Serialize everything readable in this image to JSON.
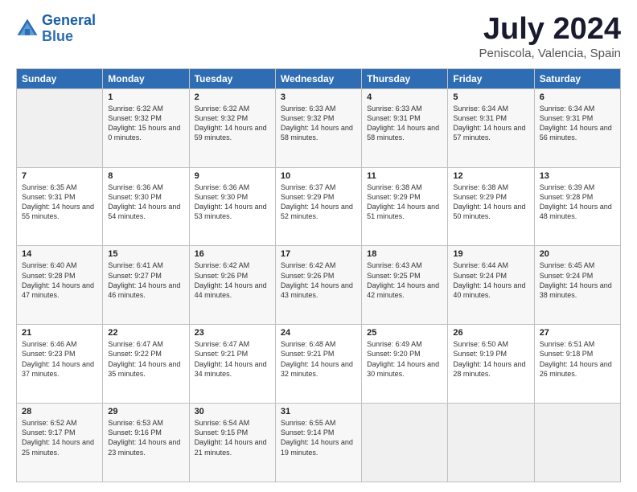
{
  "logo": {
    "line1": "General",
    "line2": "Blue"
  },
  "title": "July 2024",
  "subtitle": "Peniscola, Valencia, Spain",
  "days_of_week": [
    "Sunday",
    "Monday",
    "Tuesday",
    "Wednesday",
    "Thursday",
    "Friday",
    "Saturday"
  ],
  "weeks": [
    [
      {
        "day": "",
        "empty": true
      },
      {
        "day": "1",
        "sunrise": "6:32 AM",
        "sunset": "9:32 PM",
        "daylight": "15 hours and 0 minutes."
      },
      {
        "day": "2",
        "sunrise": "6:32 AM",
        "sunset": "9:32 PM",
        "daylight": "14 hours and 59 minutes."
      },
      {
        "day": "3",
        "sunrise": "6:33 AM",
        "sunset": "9:32 PM",
        "daylight": "14 hours and 58 minutes."
      },
      {
        "day": "4",
        "sunrise": "6:33 AM",
        "sunset": "9:31 PM",
        "daylight": "14 hours and 58 minutes."
      },
      {
        "day": "5",
        "sunrise": "6:34 AM",
        "sunset": "9:31 PM",
        "daylight": "14 hours and 57 minutes."
      },
      {
        "day": "6",
        "sunrise": "6:34 AM",
        "sunset": "9:31 PM",
        "daylight": "14 hours and 56 minutes."
      }
    ],
    [
      {
        "day": "7",
        "sunrise": "6:35 AM",
        "sunset": "9:31 PM",
        "daylight": "14 hours and 55 minutes."
      },
      {
        "day": "8",
        "sunrise": "6:36 AM",
        "sunset": "9:30 PM",
        "daylight": "14 hours and 54 minutes."
      },
      {
        "day": "9",
        "sunrise": "6:36 AM",
        "sunset": "9:30 PM",
        "daylight": "14 hours and 53 minutes."
      },
      {
        "day": "10",
        "sunrise": "6:37 AM",
        "sunset": "9:29 PM",
        "daylight": "14 hours and 52 minutes."
      },
      {
        "day": "11",
        "sunrise": "6:38 AM",
        "sunset": "9:29 PM",
        "daylight": "14 hours and 51 minutes."
      },
      {
        "day": "12",
        "sunrise": "6:38 AM",
        "sunset": "9:29 PM",
        "daylight": "14 hours and 50 minutes."
      },
      {
        "day": "13",
        "sunrise": "6:39 AM",
        "sunset": "9:28 PM",
        "daylight": "14 hours and 48 minutes."
      }
    ],
    [
      {
        "day": "14",
        "sunrise": "6:40 AM",
        "sunset": "9:28 PM",
        "daylight": "14 hours and 47 minutes."
      },
      {
        "day": "15",
        "sunrise": "6:41 AM",
        "sunset": "9:27 PM",
        "daylight": "14 hours and 46 minutes."
      },
      {
        "day": "16",
        "sunrise": "6:42 AM",
        "sunset": "9:26 PM",
        "daylight": "14 hours and 44 minutes."
      },
      {
        "day": "17",
        "sunrise": "6:42 AM",
        "sunset": "9:26 PM",
        "daylight": "14 hours and 43 minutes."
      },
      {
        "day": "18",
        "sunrise": "6:43 AM",
        "sunset": "9:25 PM",
        "daylight": "14 hours and 42 minutes."
      },
      {
        "day": "19",
        "sunrise": "6:44 AM",
        "sunset": "9:24 PM",
        "daylight": "14 hours and 40 minutes."
      },
      {
        "day": "20",
        "sunrise": "6:45 AM",
        "sunset": "9:24 PM",
        "daylight": "14 hours and 38 minutes."
      }
    ],
    [
      {
        "day": "21",
        "sunrise": "6:46 AM",
        "sunset": "9:23 PM",
        "daylight": "14 hours and 37 minutes."
      },
      {
        "day": "22",
        "sunrise": "6:47 AM",
        "sunset": "9:22 PM",
        "daylight": "14 hours and 35 minutes."
      },
      {
        "day": "23",
        "sunrise": "6:47 AM",
        "sunset": "9:21 PM",
        "daylight": "14 hours and 34 minutes."
      },
      {
        "day": "24",
        "sunrise": "6:48 AM",
        "sunset": "9:21 PM",
        "daylight": "14 hours and 32 minutes."
      },
      {
        "day": "25",
        "sunrise": "6:49 AM",
        "sunset": "9:20 PM",
        "daylight": "14 hours and 30 minutes."
      },
      {
        "day": "26",
        "sunrise": "6:50 AM",
        "sunset": "9:19 PM",
        "daylight": "14 hours and 28 minutes."
      },
      {
        "day": "27",
        "sunrise": "6:51 AM",
        "sunset": "9:18 PM",
        "daylight": "14 hours and 26 minutes."
      }
    ],
    [
      {
        "day": "28",
        "sunrise": "6:52 AM",
        "sunset": "9:17 PM",
        "daylight": "14 hours and 25 minutes."
      },
      {
        "day": "29",
        "sunrise": "6:53 AM",
        "sunset": "9:16 PM",
        "daylight": "14 hours and 23 minutes."
      },
      {
        "day": "30",
        "sunrise": "6:54 AM",
        "sunset": "9:15 PM",
        "daylight": "14 hours and 21 minutes."
      },
      {
        "day": "31",
        "sunrise": "6:55 AM",
        "sunset": "9:14 PM",
        "daylight": "14 hours and 19 minutes."
      },
      {
        "day": "",
        "empty": true
      },
      {
        "day": "",
        "empty": true
      },
      {
        "day": "",
        "empty": true
      }
    ]
  ],
  "labels": {
    "sunrise_prefix": "Sunrise: ",
    "sunset_prefix": "Sunset: ",
    "daylight_prefix": "Daylight: "
  }
}
